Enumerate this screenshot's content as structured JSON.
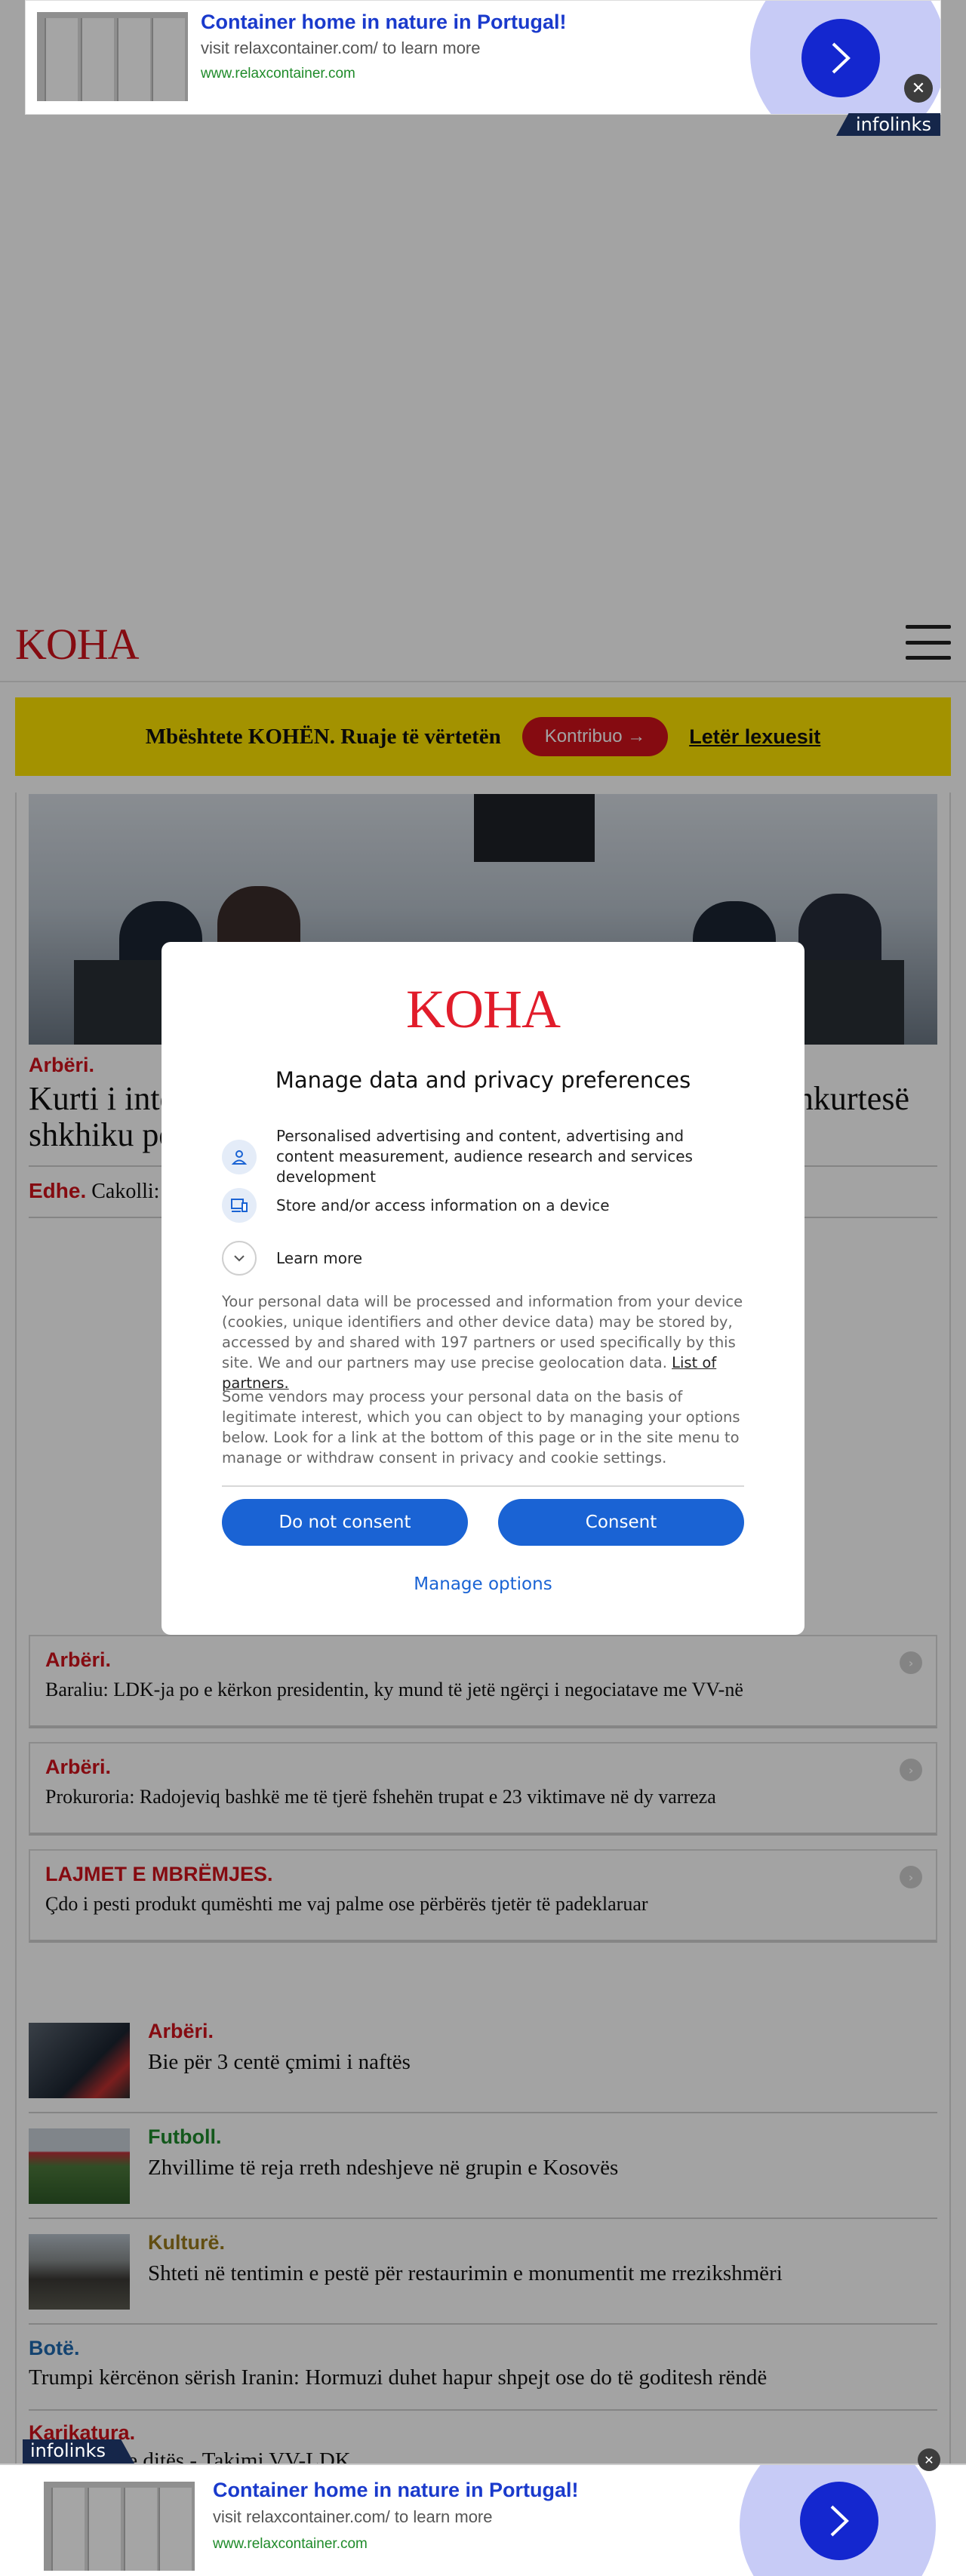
{
  "top_ad": {
    "title": "Container home in nature in Portugal!",
    "subtitle": "visit relaxcontainer.com/ to learn more",
    "url": "www.relaxcontainer.com",
    "close": "✕",
    "badge": "infolinks"
  },
  "header": {
    "logo": "KOHA"
  },
  "support_bar": {
    "text": "Mbështete KOHËN. Ruaje të vërtetën",
    "contribute_label": "Kontribuo",
    "newsletter_label": "Letër lexuesit"
  },
  "main_article": {
    "category": "Arbëri.",
    "title": "Kurti i interesuar për Ahmetin, sipas Isufit, LDK kërkon shkurtesë shkhiku për balancë i",
    "also_tag": "Edhe.",
    "also_text": "Cakolli: L"
  },
  "related": [
    {
      "category": "Arbëri.",
      "text": "Baraliu: LDK-ja po e kërkon presidentin, ky mund të jetë ngërçi i negociatave me VV-në"
    },
    {
      "category": "Arbëri.",
      "text": "Prokuroria: Radojeviq bashkë me të tjerë fshehën trupat e 23 viktimave në dy varreza"
    },
    {
      "category": "LAJMET E MBRËMJES.",
      "text": "Çdo i pesti produkt qumështi me vaj palme ose përbërës tjetër të padeklaruar"
    }
  ],
  "list": [
    {
      "category": "Arbëri.",
      "title": "Bie për 3 centë çmimi i naftës"
    },
    {
      "category": "Futboll.",
      "title": "Zhvillime të reja rreth ndeshjeve në grupin e Kosovës"
    },
    {
      "category": "Kulturë.",
      "title": "Shteti në tentimin e pestë për restaurimin e monumentit me rrezikshmëri"
    },
    {
      "category": "Botë.",
      "title": "Trumpi kërcënon sërish Iranin: Hormuzi duhet hapur shpejt ose do të goditesh rëndë"
    },
    {
      "category": "Karikatura.",
      "title": "Karikatura e ditës - Takimi VV-LDK"
    }
  ],
  "consent": {
    "logo": "KOHA",
    "title": "Manage data and privacy preferences",
    "purposes": [
      "Personalised advertising and content, advertising and content measurement, audience research and services development",
      "Store and/or access information on a device",
      "Learn more"
    ],
    "paragraph1": "Your personal data will be processed and information from your device (cookies, unique identifiers and other device data) may be stored by, accessed by and shared with 197 partners or used specifically by this site. We and our partners may use precise geolocation data.",
    "partners_link": "List of partners.",
    "paragraph2": "Some vendors may process your personal data on the basis of legitimate interest, which you can object to by managing your options below. Look for a link at the bottom of this page or in the site menu to manage or withdraw consent in privacy and cookie settings.",
    "reject_label": "Do not consent",
    "accept_label": "Consent",
    "manage_label": "Manage options"
  },
  "bottom_ad": {
    "title": "Container home in nature in Portugal!",
    "subtitle": "visit relaxcontainer.com/ to learn more",
    "url": "www.relaxcontainer.com",
    "close": "✕",
    "badge": "infolinks"
  }
}
